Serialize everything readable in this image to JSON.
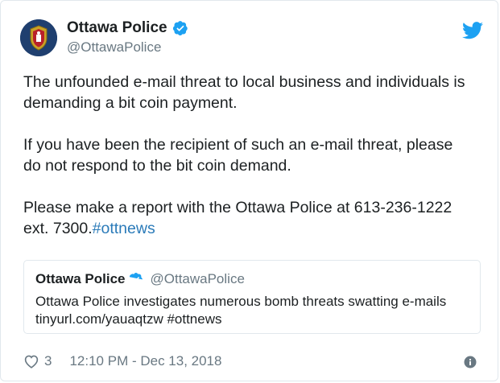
{
  "tweet": {
    "author": {
      "display_name": "Ottawa Police",
      "handle": "@OttawaPolice"
    },
    "body": {
      "paragraph_1": "The unfounded e-mail threat to local business and individuals is demanding a bit coin payment.",
      "paragraph_2": "If you have been the recipient of such an e-mail threat, please do not respond to the bit coin demand.",
      "paragraph_3_text": "Please make a report with the Ottawa Police at 613-236-1222 ext. 7300.",
      "paragraph_3_hashtag": "#ottnews"
    },
    "quoted": {
      "display_name": "Ottawa Police",
      "handle": "@OttawaPolice",
      "text": "Ottawa Police investigates numerous bomb threats swatting e-mails tinyurl.com/yauaqtzw #ottnews"
    },
    "footer": {
      "like_count": "3",
      "timestamp": "12:10 PM - Dec 13, 2018"
    }
  },
  "icons": {
    "avatar": "ottawa-police-crest",
    "verified": "verified-badge-icon",
    "brand": "twitter-bird-icon",
    "like": "heart-icon",
    "info": "info-icon"
  },
  "colors": {
    "twitter_blue": "#1da1f2",
    "link_blue": "#2b7bb9",
    "muted_gray": "#697882",
    "text_dark": "#1c2022",
    "border": "#e1e8ed"
  }
}
